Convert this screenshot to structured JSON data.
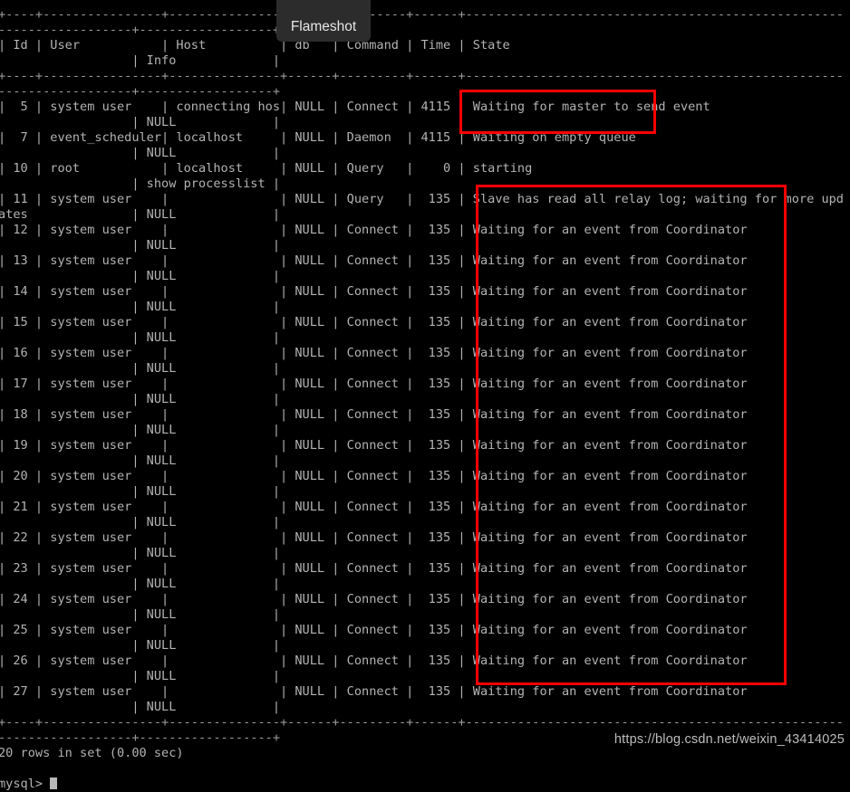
{
  "terminal": {
    "text_color": "#b3b3b3",
    "background_color": "#000000",
    "prompt": "mysql> ",
    "result_line": "20 rows in set (0.00 sec)",
    "separator_line_1": "+----+----------------+---------------+------+---------+------+-----------------------------------------------------------",
    "separator_line_2": "-----+-----------------+",
    "header_line_1": "| Id | User           | Host          | Command | Time | State",
    "header_line_2": "     | Info           |",
    "columns": [
      "Id",
      "User",
      "Host",
      "db",
      "Command",
      "Time",
      "State",
      "Info"
    ],
    "lines": [
      "+----+----------------+---------------+------+---------+------+-----------------------------------------------------------",
      "| Id | User           | Host          |      ommand | Time | State",
      "     | Info           |",
      "+----+----------------+---------------+------+---------+------+-----------------------------------------------------------",
      "-----+-----------------+",
      "|  5 | system user    | connecting host | NULL | Connect | 4115 | Waiting for master to send event",
      "     | NULL           |",
      "|  7 | event_scheduler | localhost      | NULL | Daemon  | 4115 | Waiting on empty queue",
      "     | NULL           |",
      "| 10 | root           | localhost      | NULL | Query   |    0 | starting",
      "     | show processlist |",
      "| 11 | system user    |                | NULL | Query   |  135 | Slave has read all relay log; waiting for more upd",
      "ates | NULL           |",
      "| 12 | system user    |                | NULL | Connect |  135 | Waiting for an event from Coordinator",
      "     | NULL           |"
    ],
    "rows": [
      {
        "id": "5",
        "user": "system user",
        "host": "connecting host",
        "db": "NULL",
        "command": "Connect",
        "time": "4115",
        "state": "Waiting for master to send event",
        "info": "NULL"
      },
      {
        "id": "7",
        "user": "event_scheduler",
        "host": "localhost",
        "db": "NULL",
        "command": "Daemon",
        "time": "4115",
        "state": "Waiting on empty queue",
        "info": "NULL"
      },
      {
        "id": "10",
        "user": "root",
        "host": "localhost",
        "db": "NULL",
        "command": "Query",
        "time": "0",
        "state": "starting",
        "info": "show processlist"
      },
      {
        "id": "11",
        "user": "system user",
        "host": "",
        "db": "NULL",
        "command": "Query",
        "time": "135",
        "state": "Slave has read all relay log; waiting for more updates",
        "info": "NULL"
      },
      {
        "id": "12",
        "user": "system user",
        "host": "",
        "db": "NULL",
        "command": "Connect",
        "time": "135",
        "state": "Waiting for an event from Coordinator",
        "info": "NULL"
      },
      {
        "id": "13",
        "user": "system user",
        "host": "",
        "db": "NULL",
        "command": "Connect",
        "time": "135",
        "state": "Waiting for an event from Coordinator",
        "info": "NULL"
      },
      {
        "id": "14",
        "user": "system user",
        "host": "",
        "db": "NULL",
        "command": "Connect",
        "time": "135",
        "state": "Waiting for an event from Coordinator",
        "info": "NULL"
      },
      {
        "id": "15",
        "user": "system user",
        "host": "",
        "db": "NULL",
        "command": "Connect",
        "time": "135",
        "state": "Waiting for an event from Coordinator",
        "info": "NULL"
      },
      {
        "id": "16",
        "user": "system user",
        "host": "",
        "db": "NULL",
        "command": "Connect",
        "time": "135",
        "state": "Waiting for an event from Coordinator",
        "info": "NULL"
      },
      {
        "id": "17",
        "user": "system user",
        "host": "",
        "db": "NULL",
        "command": "Connect",
        "time": "135",
        "state": "Waiting for an event from Coordinator",
        "info": "NULL"
      },
      {
        "id": "18",
        "user": "system user",
        "host": "",
        "db": "NULL",
        "command": "Connect",
        "time": "135",
        "state": "Waiting for an event from Coordinator",
        "info": "NULL"
      },
      {
        "id": "19",
        "user": "system user",
        "host": "",
        "db": "NULL",
        "command": "Connect",
        "time": "135",
        "state": "Waiting for an event from Coordinator",
        "info": "NULL"
      },
      {
        "id": "20",
        "user": "system user",
        "host": "",
        "db": "NULL",
        "command": "Connect",
        "time": "135",
        "state": "Waiting for an event from Coordinator",
        "info": "NULL"
      },
      {
        "id": "21",
        "user": "system user",
        "host": "",
        "db": "NULL",
        "command": "Connect",
        "time": "135",
        "state": "Waiting for an event from Coordinator",
        "info": "NULL"
      },
      {
        "id": "22",
        "user": "system user",
        "host": "",
        "db": "NULL",
        "command": "Connect",
        "time": "135",
        "state": "Waiting for an event from Coordinator",
        "info": "NULL"
      },
      {
        "id": "23",
        "user": "system user",
        "host": "",
        "db": "NULL",
        "command": "Connect",
        "time": "135",
        "state": "Waiting for an event from Coordinator",
        "info": "NULL"
      },
      {
        "id": "24",
        "user": "system user",
        "host": "",
        "db": "NULL",
        "command": "Connect",
        "time": "135",
        "state": "Waiting for an event from Coordinator",
        "info": "NULL"
      },
      {
        "id": "25",
        "user": "system user",
        "host": "",
        "db": "NULL",
        "command": "Connect",
        "time": "135",
        "state": "Waiting for an event from Coordinator",
        "info": "NULL"
      },
      {
        "id": "26",
        "user": "system user",
        "host": "",
        "db": "NULL",
        "command": "Connect",
        "time": "135",
        "state": "Waiting for an event from Coordinator",
        "info": "NULL"
      },
      {
        "id": "27",
        "user": "system user",
        "host": "",
        "db": "NULL",
        "command": "Connect",
        "time": "135",
        "state": "Waiting for an event from Coordinator",
        "info": "NULL"
      }
    ]
  },
  "flameshot": {
    "label": "Flameshot",
    "background_color": "#2c2c2c",
    "text_color": "#e6e6e6"
  },
  "annotations": {
    "color": "#fe0000",
    "small_box_target": "Waiting on empty queue",
    "large_box_target": "Waiting for an event from Coordinator"
  },
  "watermark": {
    "text": "https://blog.csdn.net/weixin_43414025"
  }
}
